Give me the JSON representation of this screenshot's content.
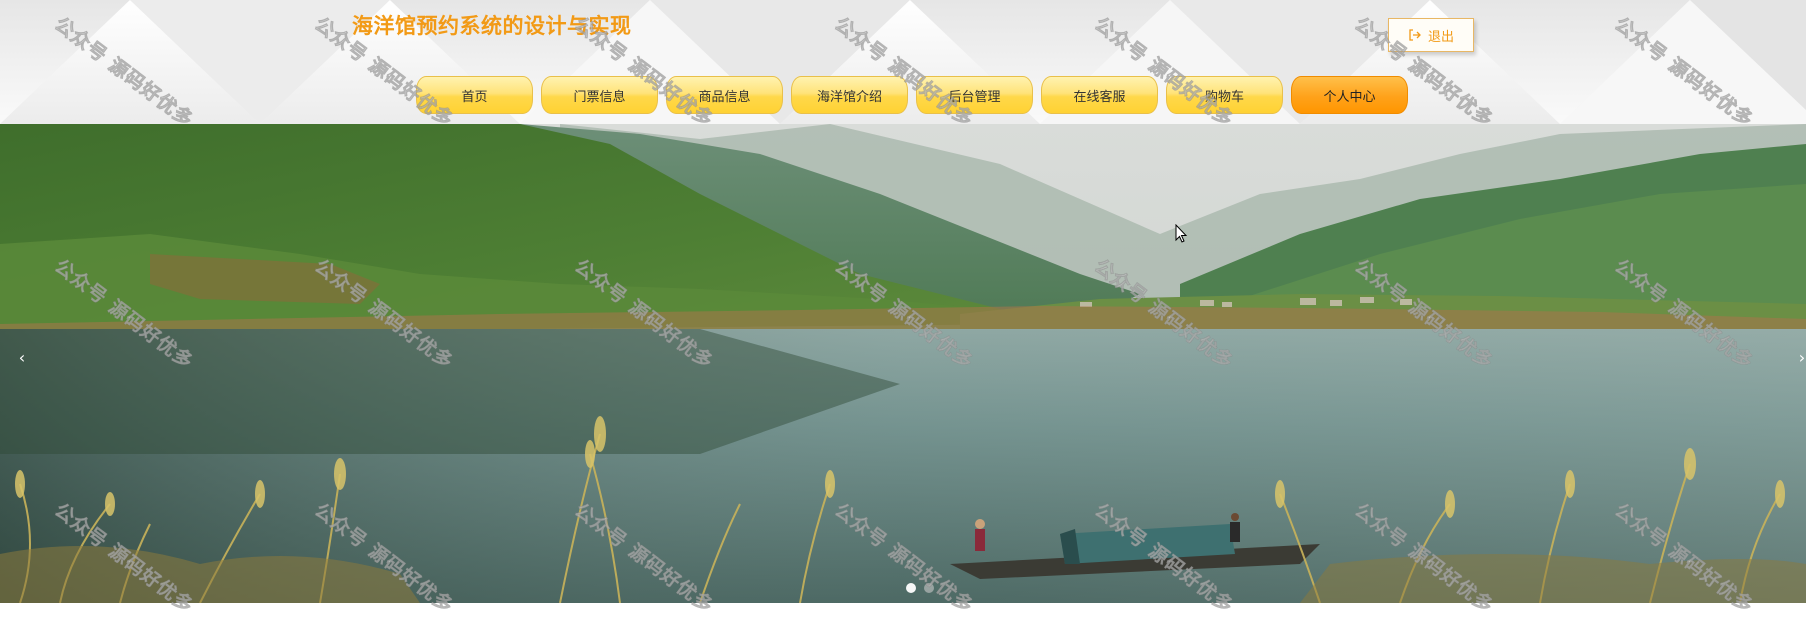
{
  "header": {
    "title": "海洋馆预约系统的设计与实现",
    "logout_label": "退出"
  },
  "nav": {
    "items": [
      {
        "label": "首页"
      },
      {
        "label": "门票信息"
      },
      {
        "label": "商品信息"
      },
      {
        "label": "海洋馆介绍"
      },
      {
        "label": "后台管理"
      },
      {
        "label": "在线客服"
      },
      {
        "label": "购物车"
      },
      {
        "label": "个人中心",
        "active": true
      }
    ]
  },
  "banner": {
    "prev_icon": "‹",
    "next_icon": "›",
    "slide_count": 2,
    "active_slide": 1
  },
  "watermark": {
    "text": "公众号 源码好优多"
  },
  "colors": {
    "title": "#f29a16",
    "nav_button": "#ffd84a",
    "nav_active": "#ff9a00"
  },
  "icons": {
    "logout": "logout-icon",
    "cursor": "mouse-pointer-icon"
  }
}
